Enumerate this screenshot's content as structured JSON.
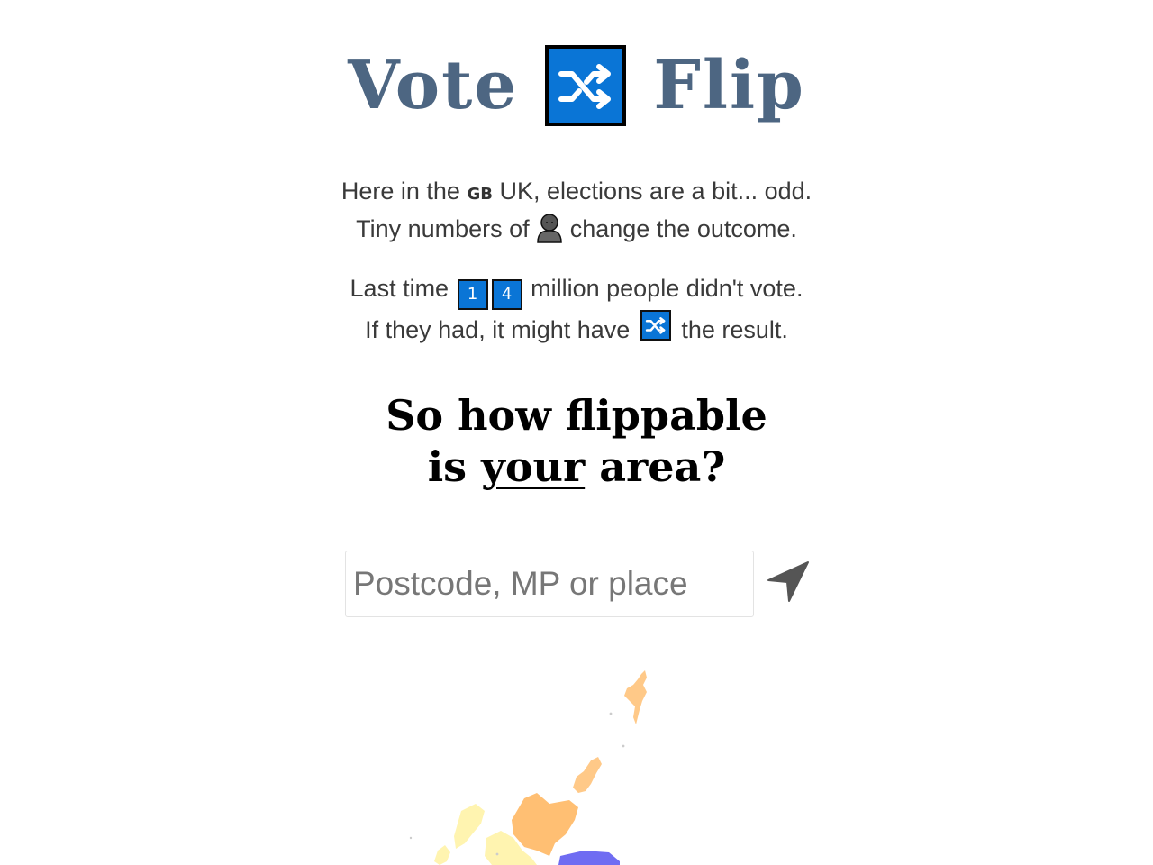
{
  "logo": {
    "word_left": "Vote",
    "word_right": "Flip",
    "icon": "shuffle-icon"
  },
  "intro": {
    "line1_pre": "Here in the",
    "line1_flag": "GB",
    "line1_post": "UK, elections are a bit... odd.",
    "line2_pre": "Tiny numbers of",
    "line2_icon": "person-icon",
    "line2_post": "change the outcome.",
    "line3_pre": "Last time",
    "line3_digit1": "1",
    "line3_digit2": "4",
    "line3_post": "million people didn't vote.",
    "line4_pre": "If they had, it might have",
    "line4_icon": "shuffle-icon",
    "line4_post": "the result."
  },
  "question": {
    "line1": "So how flippable",
    "line2_pre": "is",
    "line2_emph": "your",
    "line2_post": "area?"
  },
  "search": {
    "placeholder": "Postcode, MP or place",
    "value": ""
  },
  "locate": {
    "icon": "location-arrow-icon"
  },
  "colors": {
    "logo_text": "#4d6682",
    "flip_blue": "#0a75d6",
    "map_orange": "#ffbf73",
    "map_yellow": "#fff4b0",
    "map_blue": "#6f6cf2"
  }
}
